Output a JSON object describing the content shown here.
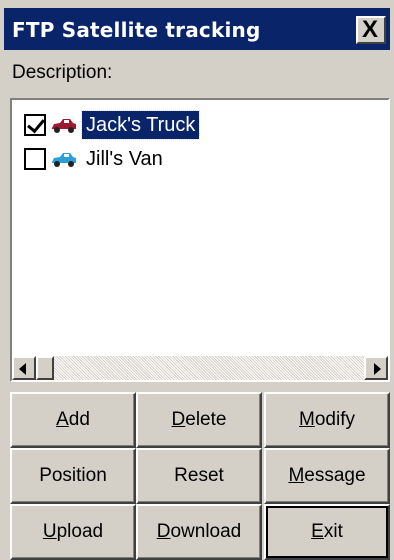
{
  "window": {
    "title": "FTP Satellite tracking",
    "close_label": "X"
  },
  "description_label": "Description:",
  "vehicles": [
    {
      "label": "Jack's Truck",
      "checked": true,
      "selected": true,
      "icon": "red-car-icon",
      "color": "#a01830"
    },
    {
      "label": "Jill's Van",
      "checked": false,
      "selected": false,
      "icon": "blue-car-icon",
      "color": "#2aa0d8"
    }
  ],
  "buttons": {
    "add": {
      "mnemonic": "A",
      "rest": "dd"
    },
    "delete": {
      "mnemonic": "D",
      "rest": "elete"
    },
    "modify": {
      "mnemonic": "M",
      "rest": "odify"
    },
    "position": {
      "label": "Position"
    },
    "reset": {
      "label": "Reset"
    },
    "message": {
      "mnemonic": "M",
      "rest": "essage"
    },
    "upload": {
      "mnemonic": "U",
      "rest": "pload"
    },
    "download": {
      "mnemonic": "D",
      "rest": "ownload"
    },
    "exit": {
      "mnemonic": "E",
      "rest": "xit"
    }
  }
}
